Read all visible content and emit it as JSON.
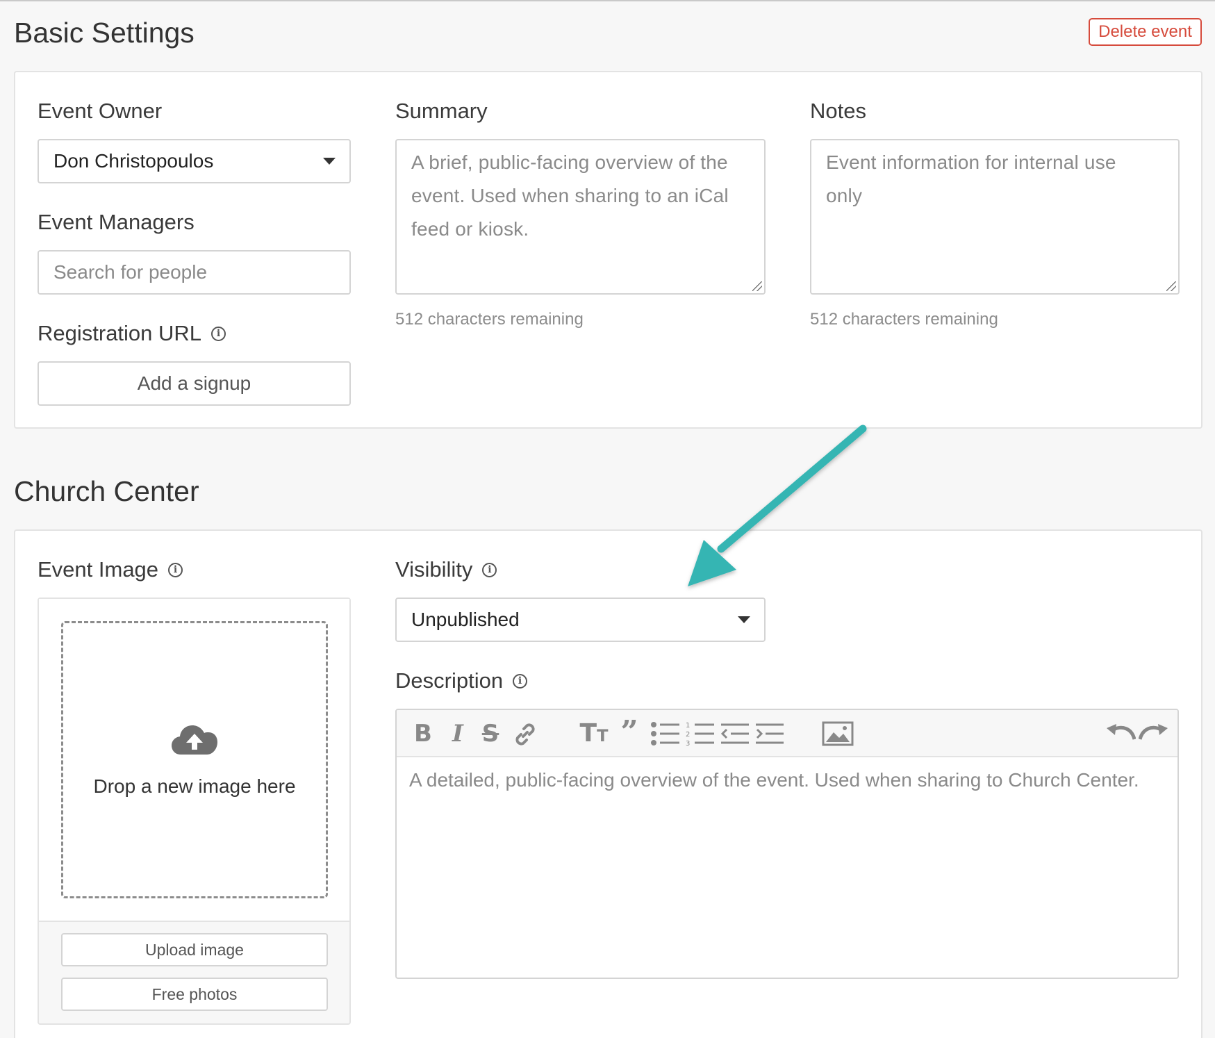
{
  "basic_settings": {
    "title": "Basic Settings",
    "delete_label": "Delete event",
    "event_owner": {
      "label": "Event Owner",
      "value": "Don Christopoulos"
    },
    "event_managers": {
      "label": "Event Managers",
      "placeholder": "Search for people"
    },
    "registration_url": {
      "label": "Registration URL",
      "button": "Add a signup"
    },
    "summary": {
      "label": "Summary",
      "placeholder": "A brief, public-facing overview of the event. Used when sharing to an iCal feed or kiosk.",
      "helper": "512 characters remaining"
    },
    "notes": {
      "label": "Notes",
      "placeholder": "Event information for internal use only",
      "helper": "512 characters remaining"
    }
  },
  "church_center": {
    "title": "Church Center",
    "event_image": {
      "label": "Event Image",
      "drop_text": "Drop a new image here",
      "upload_button": "Upload image",
      "free_photos_button": "Free photos"
    },
    "visibility": {
      "label": "Visibility",
      "value": "Unpublished"
    },
    "description": {
      "label": "Description",
      "placeholder": "A detailed, public-facing overview of the event. Used when sharing to Church Center.",
      "toolbar": [
        "bold-icon",
        "italic-icon",
        "strikethrough-icon",
        "link-icon",
        "heading-icon",
        "quote-icon",
        "bullet-list-icon",
        "numbered-list-icon",
        "outdent-icon",
        "indent-icon",
        "image-icon",
        "undo-icon",
        "redo-icon"
      ]
    }
  },
  "annotation": {
    "arrow_color": "#36b5b3"
  },
  "colors": {
    "danger": "#d64b3c",
    "background": "#f7f7f7"
  }
}
